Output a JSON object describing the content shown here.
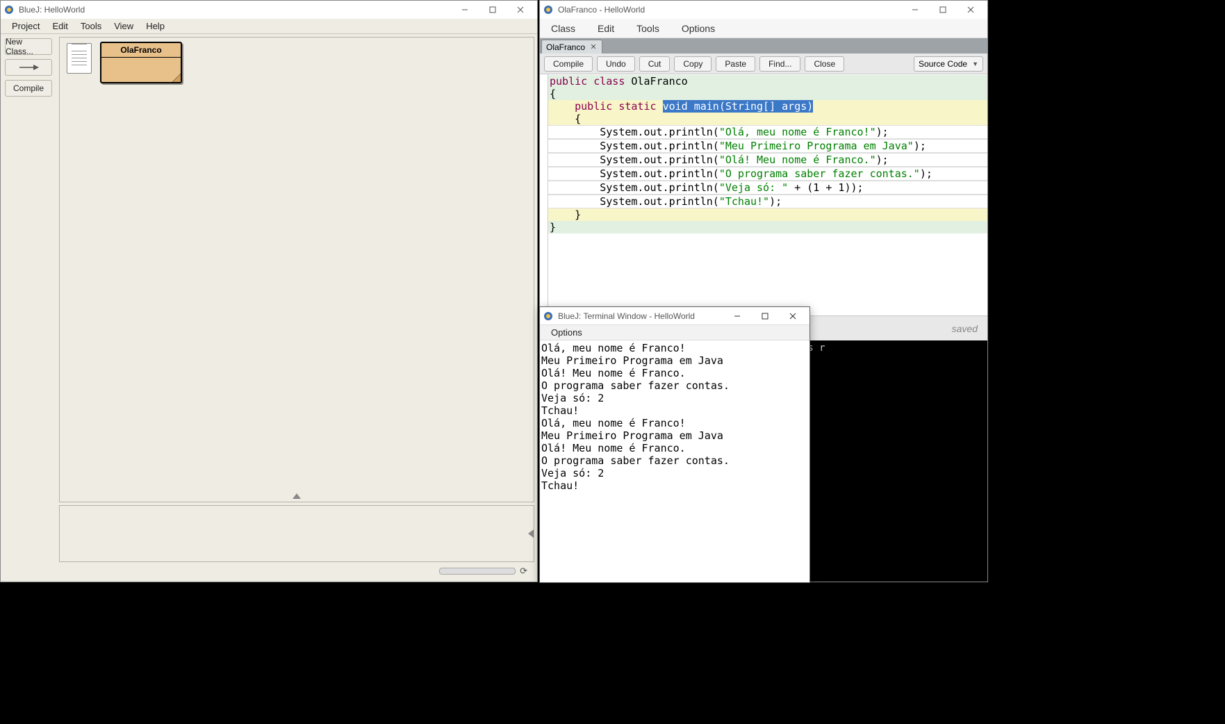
{
  "main": {
    "title": "BlueJ:  HelloWorld",
    "menu": [
      "Project",
      "Edit",
      "Tools",
      "View",
      "Help"
    ],
    "toolbar": {
      "new_class": "New Class...",
      "compile": "Compile"
    },
    "class_box": {
      "name": "OlaFranco"
    }
  },
  "editor": {
    "title": "OlaFranco - HelloWorld",
    "menu": [
      "Class",
      "Edit",
      "Tools",
      "Options"
    ],
    "tab": {
      "label": "OlaFranco"
    },
    "toolbar": {
      "compile": "Compile",
      "undo": "Undo",
      "cut": "Cut",
      "copy": "Copy",
      "paste": "Paste",
      "find": "Find...",
      "close": "Close",
      "view": "Source Code"
    },
    "code": {
      "l1a": "public",
      "l1b": "class",
      "l1c": "OlaFranco",
      "l2": "{",
      "l3a": "public",
      "l3b": "static",
      "l3c": "void",
      "l3d": "main(String[] args)",
      "l4": "{",
      "s1": "\"Olá, meu nome é Franco!\"",
      "s2": "\"Meu Primeiro Programa em Java\"",
      "s3": "\"Olá! Meu nome é Franco.\"",
      "s4": "\"O programa saber fazer contas.\"",
      "s5": "\"Veja só: \"",
      "s5b": " + (1 + 1));",
      "s6": "\"Tchau!\"",
      "sop": "System.out.println(",
      "close_paren": ");",
      "l_end1": "}",
      "l_end2": "}"
    },
    "status": "saved",
    "hidden_input": "Can only enter input while your programming is r"
  },
  "terminal": {
    "title": "BlueJ: Terminal Window - HelloWorld",
    "menu": [
      "Options"
    ],
    "lines": [
      "Olá, meu nome é Franco!",
      "Meu Primeiro Programa em Java",
      "Olá! Meu nome é Franco.",
      "O programa saber fazer contas.",
      "Veja só: 2",
      "Tchau!",
      "Olá, meu nome é Franco!",
      "Meu Primeiro Programa em Java",
      "Olá! Meu nome é Franco.",
      "O programa saber fazer contas.",
      "Veja só: 2",
      "Tchau!"
    ]
  }
}
